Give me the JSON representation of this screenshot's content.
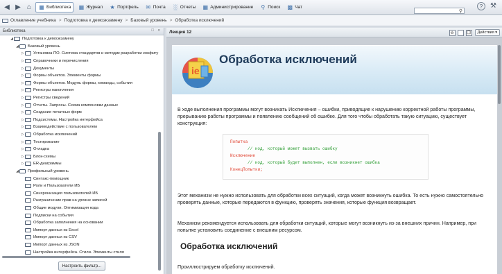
{
  "toolbar": {
    "library": "Библиотека",
    "journal": "Журнал",
    "portfolio": "Портфель",
    "mail": "Почта",
    "reports": "Отчеты",
    "admin": "Администрирование",
    "search": "Поиск",
    "chat": "Чат"
  },
  "breadcrumb": [
    "Оглавление учебника",
    "Подготовка к демоэкзамену",
    "Базовый уровень",
    "Обработка исключений"
  ],
  "library_panel": {
    "title": "Библиотека",
    "filter_button": "Настроить фильтр...",
    "tree": [
      {
        "label": "Подготовка к демоэкзамену",
        "level": 0,
        "state": "open"
      },
      {
        "label": "Базовый уровень",
        "level": 1,
        "state": "open"
      },
      {
        "label": "Установка ПО. Система стандартов и методик разработки конфигу",
        "level": 2,
        "state": "closed"
      },
      {
        "label": "Справочники и перечисления",
        "level": 2,
        "state": "closed"
      },
      {
        "label": "Документы",
        "level": 2,
        "state": "closed"
      },
      {
        "label": "Формы объектов. Элементы формы",
        "level": 2,
        "state": "closed"
      },
      {
        "label": "Формы объектов. Модуль формы, команды, события",
        "level": 2,
        "state": "closed"
      },
      {
        "label": "Регистры накопления",
        "level": 2,
        "state": "closed"
      },
      {
        "label": "Регистры сведений",
        "level": 2,
        "state": "closed"
      },
      {
        "label": "Отчеты. Запросы. Схема компоновки данных",
        "level": 2,
        "state": "closed"
      },
      {
        "label": "Создание печатных форм",
        "level": 2,
        "state": "closed"
      },
      {
        "label": "Подсистемы. Настройка интерфейса",
        "level": 2,
        "state": "closed"
      },
      {
        "label": "Взаимодействие с пользователем",
        "level": 2,
        "state": "closed"
      },
      {
        "label": "Обработка исключений",
        "level": 2,
        "state": "closed"
      },
      {
        "label": "Тестирование",
        "level": 2,
        "state": "closed"
      },
      {
        "label": "Отладка",
        "level": 2,
        "state": "closed"
      },
      {
        "label": "Блок-схемы",
        "level": 2,
        "state": "closed"
      },
      {
        "label": "ER-диаграммы",
        "level": 2,
        "state": "closed"
      },
      {
        "label": "Профильный уровень",
        "level": 1,
        "state": "open"
      },
      {
        "label": "Синтакс-помощник",
        "level": 2,
        "state": "leaf"
      },
      {
        "label": "Роли и Пользователи ИБ",
        "level": 2,
        "state": "leaf"
      },
      {
        "label": "Синхронизация пользователей ИБ",
        "level": 2,
        "state": "leaf"
      },
      {
        "label": "Разграничение прав на уровне записей",
        "level": 2,
        "state": "leaf"
      },
      {
        "label": "Общие модули. Оптимизация кода",
        "level": 2,
        "state": "leaf"
      },
      {
        "label": "Подписки на события",
        "level": 2,
        "state": "leaf"
      },
      {
        "label": "Обработка заполнения на основании",
        "level": 2,
        "state": "leaf"
      },
      {
        "label": "Импорт данных из Excel",
        "level": 2,
        "state": "leaf"
      },
      {
        "label": "Импорт данных из CSV",
        "level": 2,
        "state": "leaf"
      },
      {
        "label": "Импорт данных из JSON",
        "level": 2,
        "state": "leaf"
      },
      {
        "label": "Настройка интерфейса. Стили. Элементы стиля",
        "level": 2,
        "state": "leaf"
      }
    ]
  },
  "lecture": {
    "header": "Лекция 12",
    "actions": "Действия",
    "title": "Обработка исключений",
    "para1": "В ходе выполнения программы могут возникать Исключения – ошибки, приводящие к нарушению корректной работы программы, прерыванию работы программы и появлению сообщений об ошибке. Для того чтобы обработать такую ситуацию, существует конструкция:",
    "code": {
      "line1": "Попытка",
      "line2": "// код, который может вызвать ошибку",
      "line3": "Исключение",
      "line4": "// код, который будет выполнен, если возникнет ошибка",
      "line5": "КонецПопытки;"
    },
    "para2": "Этот механизм не нужно использовать для обработки всех ситуаций, когда может возникнуть ошибка. То есть нужно самостоятельно проверять данные, которые передаются в функцию, проверять значения, которые функция возвращает.",
    "para3": "Механизм рекомендуется использовать для обработки ситуаций, которые могут возникнуть из-за внешних причин. Например, при попытке установить соединение с внешним ресурсом.",
    "heading2": "Обработка исключений",
    "para4": "Проиллюстрируем обработку исключений."
  }
}
